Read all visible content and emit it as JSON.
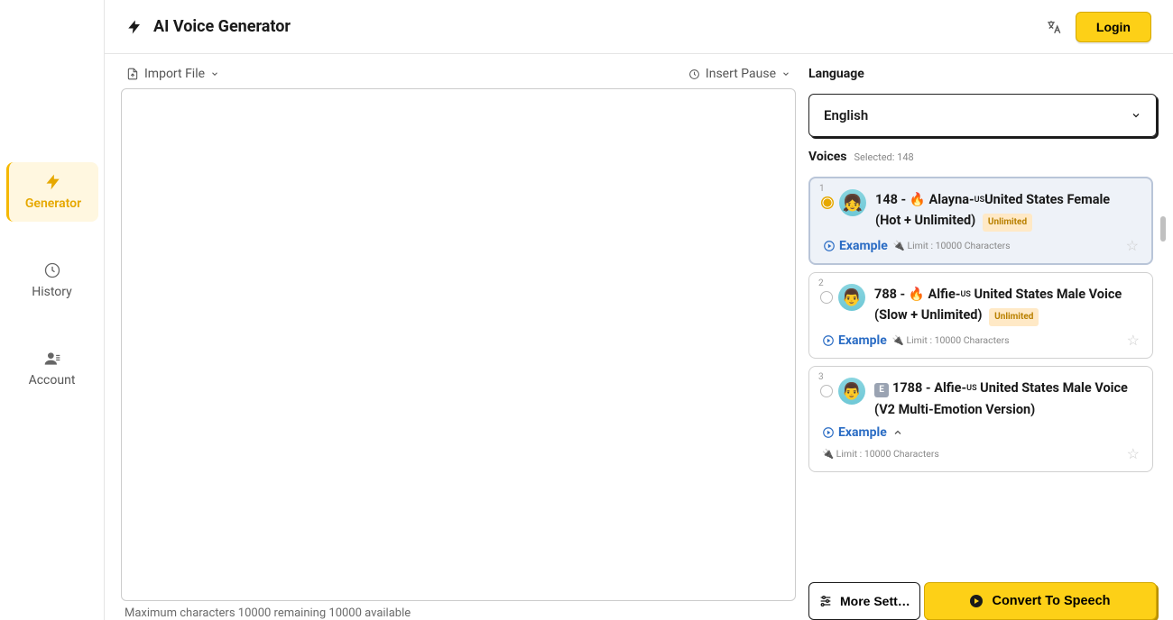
{
  "header": {
    "title": "AI Voice Generator",
    "login_label": "Login"
  },
  "sidebar": {
    "items": [
      {
        "label": "Generator",
        "active": true
      },
      {
        "label": "History",
        "active": false
      },
      {
        "label": "Account",
        "active": false
      }
    ]
  },
  "toolbar": {
    "import_label": "Import File",
    "pause_label": "Insert Pause"
  },
  "editor": {
    "char_info": "Maximum characters 10000 remaining 10000 available"
  },
  "language": {
    "label": "Language",
    "value": "English"
  },
  "voices": {
    "label": "Voices",
    "selected_text": "Selected: 148",
    "example_label": "Example",
    "items": [
      {
        "idx": "1",
        "selected": true,
        "id": "148",
        "flame": true,
        "name_pre": "Alayna-",
        "country": "US",
        "name_post": "United States Female (Hot + Unlimited)",
        "unlimited": true,
        "badge_e": false,
        "limit": "Limit : 10000 Characters",
        "expand": false
      },
      {
        "idx": "2",
        "selected": false,
        "id": "788",
        "flame": true,
        "name_pre": "Alfie-",
        "country": "US",
        "name_post": " United States Male Voice (Slow + Unlimited)",
        "unlimited": true,
        "badge_e": false,
        "limit": "Limit : 10000 Characters",
        "expand": false
      },
      {
        "idx": "3",
        "selected": false,
        "id": "1788",
        "flame": false,
        "name_pre": "Alfie-",
        "country": "US",
        "name_post": " United States Male Voice (V2 Multi-Emotion Version)",
        "unlimited": false,
        "badge_e": true,
        "limit": "Limit : 10000 Characters",
        "expand": true
      }
    ]
  },
  "actions": {
    "more_label": "More Sett…",
    "convert_label": "Convert To Speech"
  }
}
